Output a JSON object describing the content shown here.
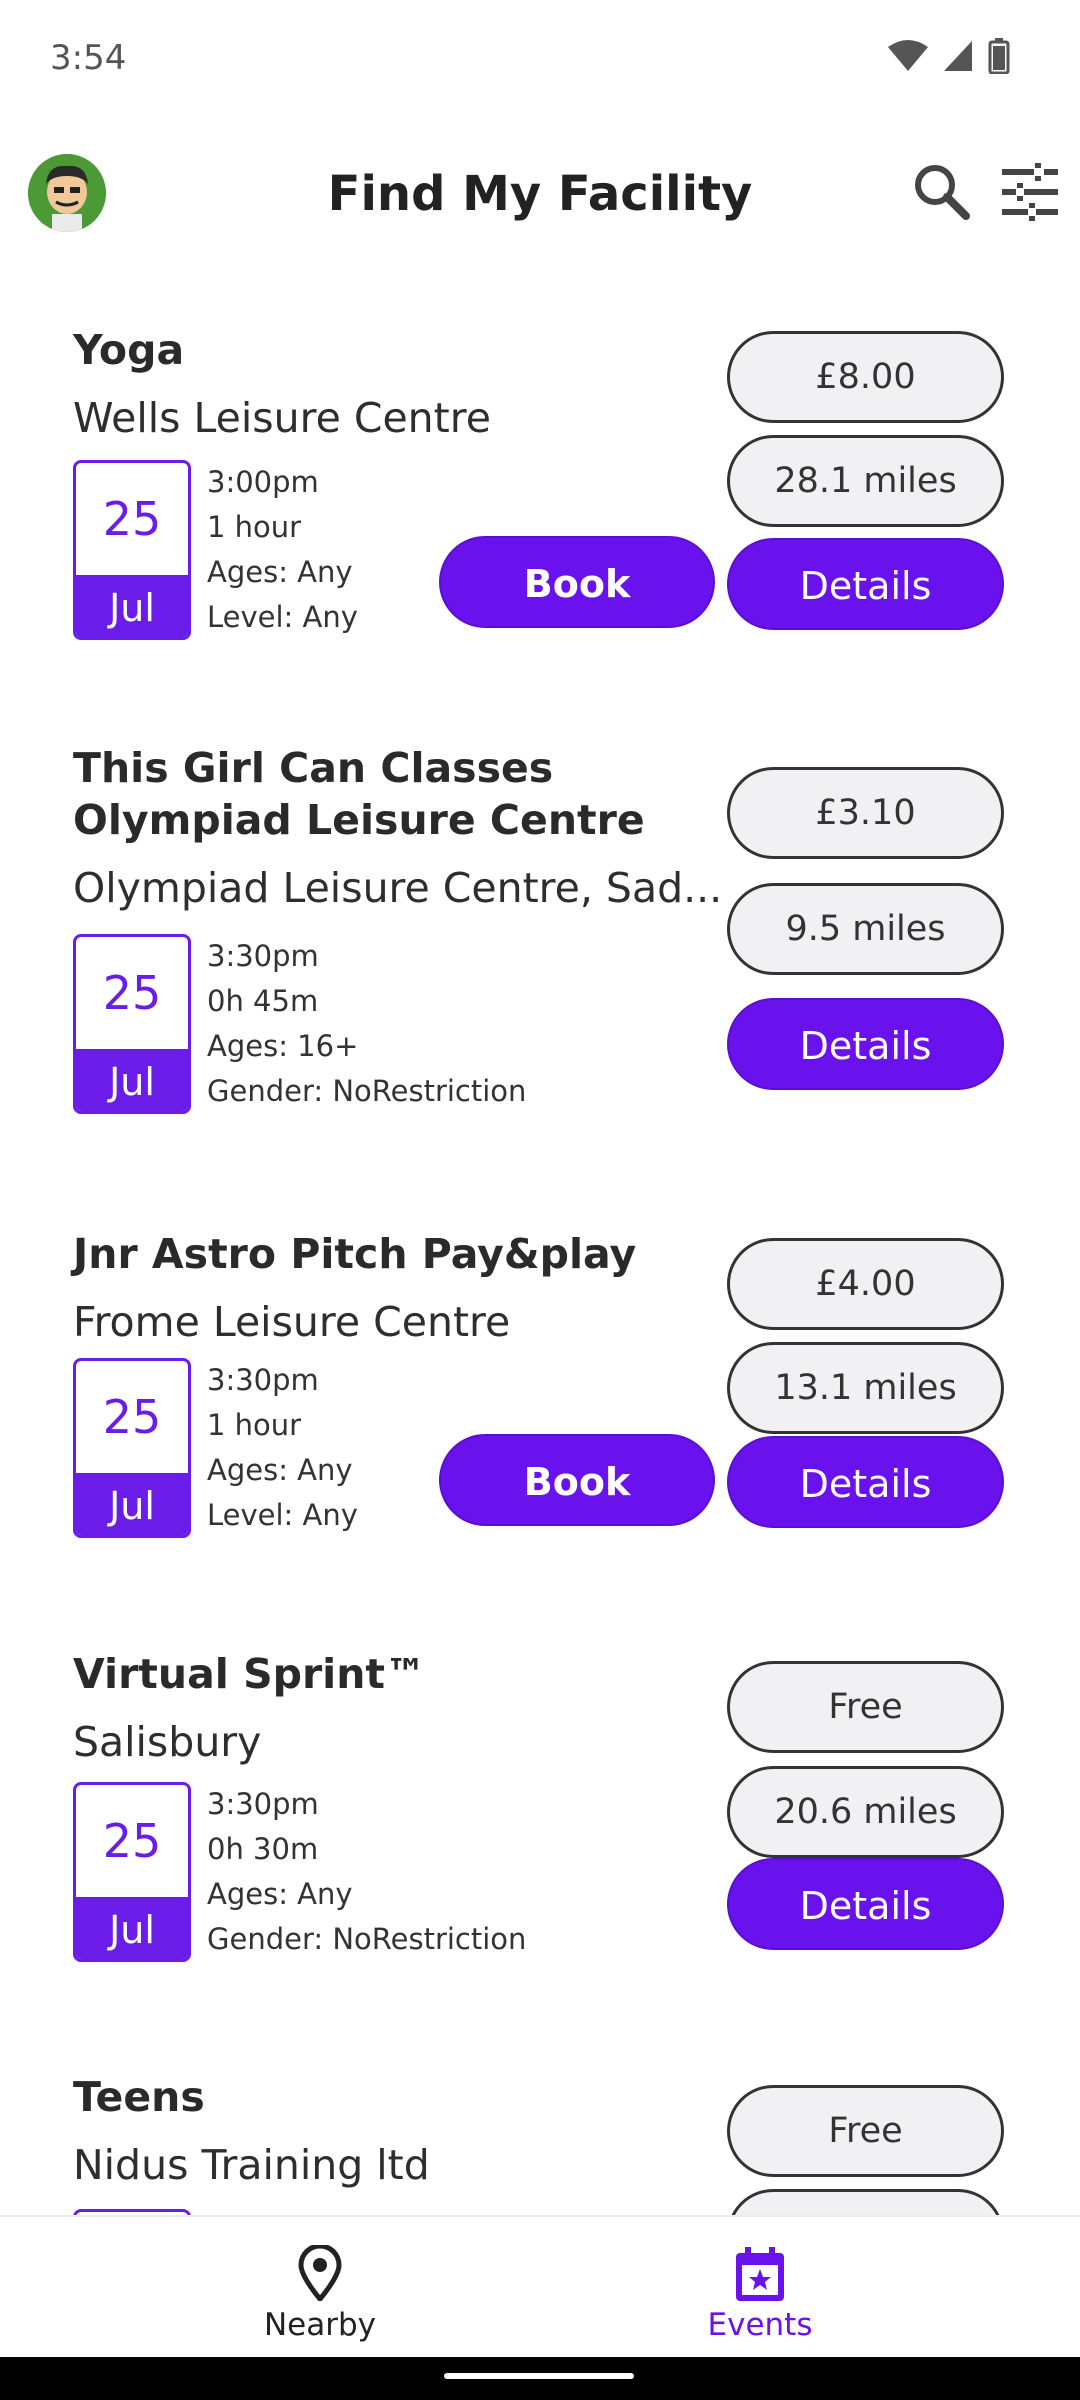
{
  "status_bar": {
    "time": "3:54"
  },
  "app_bar": {
    "title": "Find My Facility"
  },
  "colors": {
    "accent": "#6a12ee",
    "pill_bg": "#f1f1f3",
    "text": "#222222"
  },
  "events": [
    {
      "title": "Yoga",
      "venue": "Wells Leisure Centre",
      "day": "25",
      "month": "Jul",
      "time": "3:00pm",
      "duration": "1 hour",
      "ages": "Ages: Any",
      "extra": "Level: Any",
      "price": "£8.00",
      "distance": "28.1 miles",
      "book_label": "Book",
      "details_label": "Details"
    },
    {
      "title": "This Girl Can Classes Olympiad Leisure Centre",
      "venue": "Olympiad Leisure Centre, Sad...",
      "day": "25",
      "month": "Jul",
      "time": "3:30pm",
      "duration": "0h 45m",
      "ages": "Ages: 16+",
      "extra": "Gender:  NoRestriction",
      "price": "£3.10",
      "distance": "9.5 miles",
      "details_label": "Details"
    },
    {
      "title": "Jnr Astro Pitch Pay&play",
      "venue": "Frome Leisure Centre",
      "day": "25",
      "month": "Jul",
      "time": "3:30pm",
      "duration": "1 hour",
      "ages": "Ages: Any",
      "extra": "Level: Any",
      "price": "£4.00",
      "distance": "13.1 miles",
      "book_label": "Book",
      "details_label": "Details"
    },
    {
      "title": "Virtual Sprint™",
      "venue": "Salisbury",
      "day": "25",
      "month": "Jul",
      "time": "3:30pm",
      "duration": "0h 30m",
      "ages": "Ages: Any",
      "extra": "Gender:  NoRestriction",
      "price": "Free",
      "distance": "20.6 miles",
      "details_label": "Details"
    },
    {
      "title": "Teens",
      "venue": "Nidus Training ltd",
      "price": "Free"
    }
  ],
  "bottom_nav": {
    "nearby": {
      "label": "Nearby",
      "icon": "location-pin-icon"
    },
    "events": {
      "label": "Events",
      "icon": "calendar-star-icon",
      "active": true
    }
  }
}
